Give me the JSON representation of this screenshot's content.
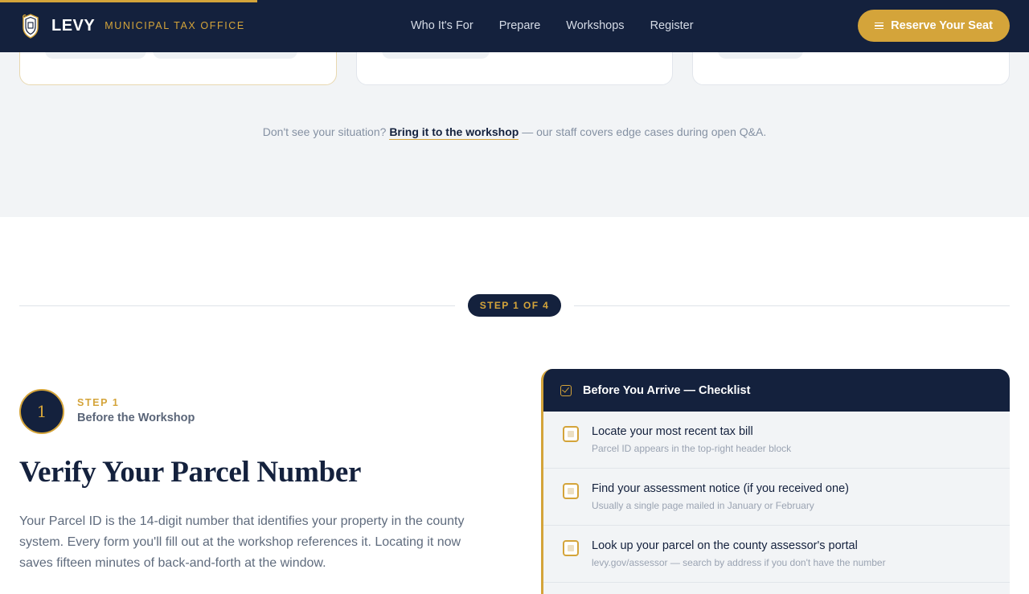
{
  "header": {
    "brand_name": "LEVY",
    "brand_sub": "MUNICIPAL TAX OFFICE",
    "nav": [
      "Who It's For",
      "Prepare",
      "Workshops",
      "Register"
    ],
    "cta_label": "Reserve Your Seat"
  },
  "situation": {
    "prefix": "Don't see your situation?",
    "link": "Bring it to the workshop",
    "suffix": "— our staff covers edge cases during open Q&A."
  },
  "step_badge": "STEP 1 OF 4",
  "step": {
    "number": "1",
    "kicker": "STEP 1",
    "subtitle": "Before the Workshop",
    "headline": "Verify Your Parcel Number",
    "body": "Your Parcel ID is the 14-digit number that identifies your property in the county system. Every form you'll fill out at the workshop references it. Locating it now saves fifteen minutes of back-and-forth at the window."
  },
  "checklist": {
    "title": "Before You Arrive — Checklist",
    "items": [
      {
        "main": "Locate your most recent tax bill",
        "note": "Parcel ID appears in the top-right header block"
      },
      {
        "main": "Find your assessment notice (if you received one)",
        "note": "Usually a single page mailed in January or February"
      },
      {
        "main": "Look up your parcel on the county assessor's portal",
        "note": "levy.gov/assessor — search by address if you don't have the number"
      }
    ]
  },
  "colors": {
    "navy": "#14213d",
    "gold": "#d4a43a",
    "grey_bg": "#f2f4f6"
  }
}
